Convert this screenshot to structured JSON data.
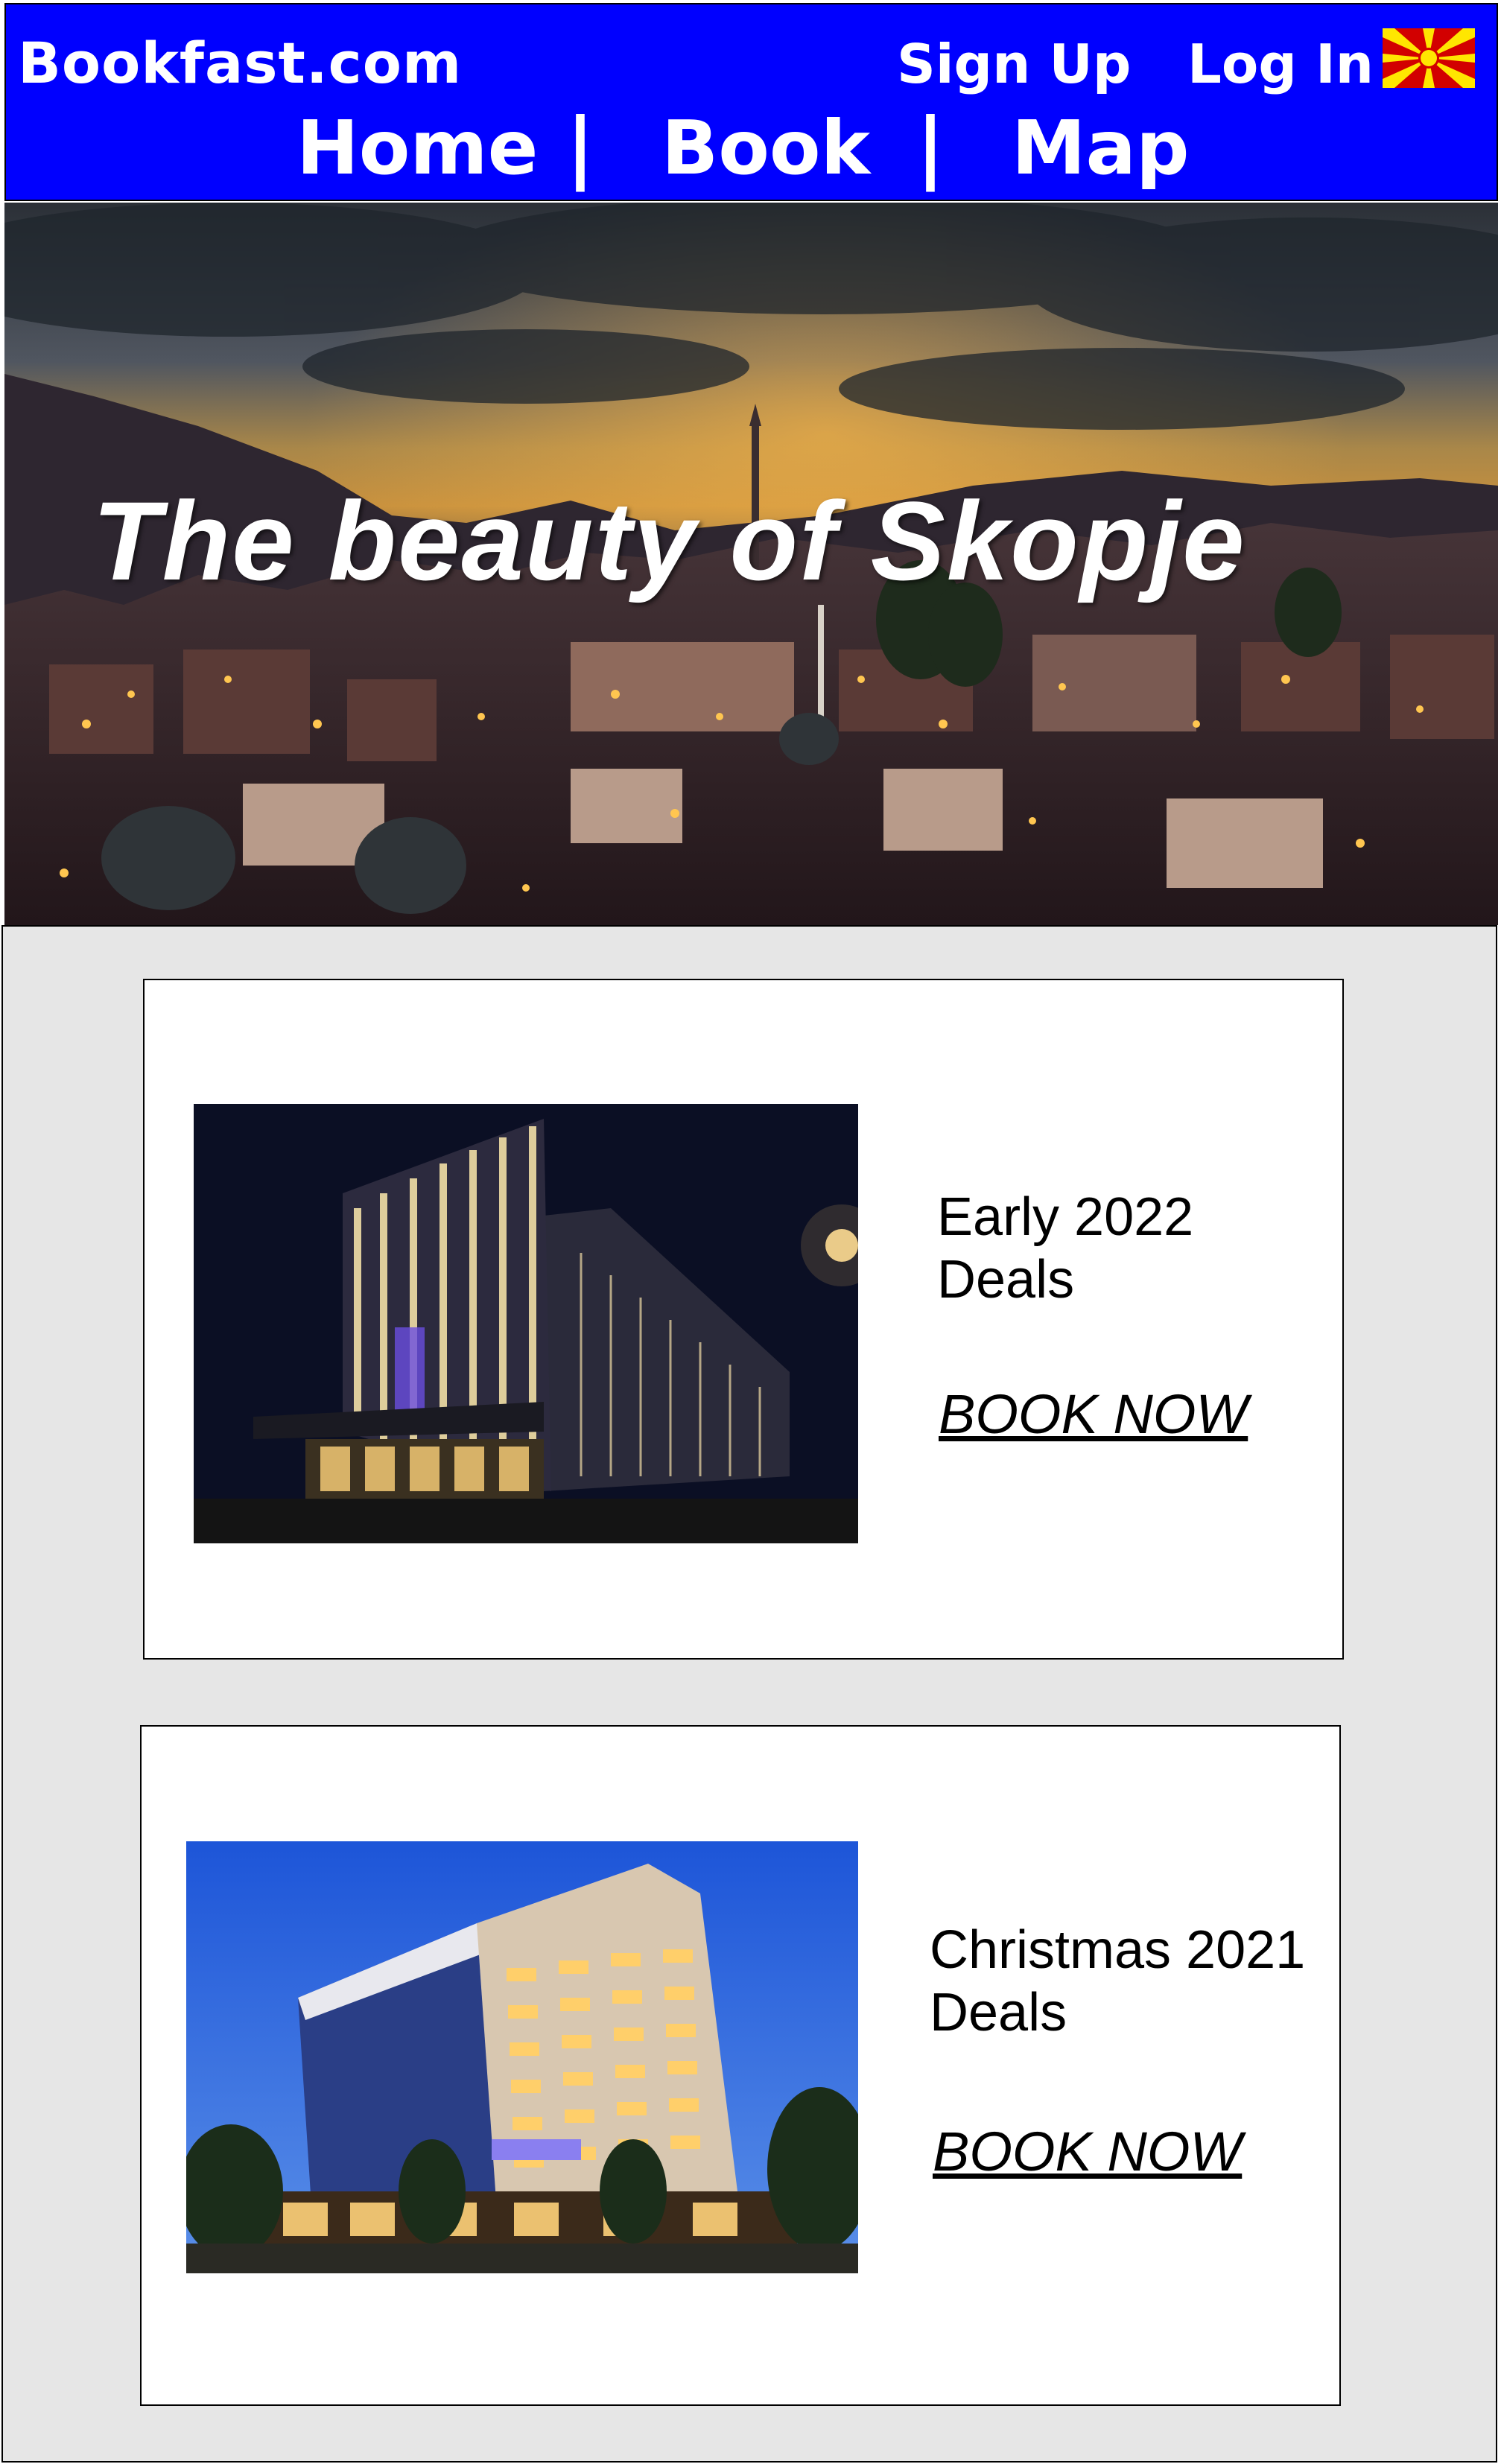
{
  "header": {
    "brand": "Bookfast.com",
    "sign_up": "Sign Up",
    "log_in": "Log In",
    "language_flag": "north-macedonia-flag-icon",
    "nav": [
      {
        "label": "Home"
      },
      {
        "label": "Book"
      },
      {
        "label": "Map"
      }
    ],
    "separator": "|",
    "background_color": "#0000ff"
  },
  "hero": {
    "title": "The beauty of Skopje",
    "image": "skopje-city-night-panorama"
  },
  "deals": [
    {
      "title": "Early 2022\nDeals",
      "cta": "BOOK NOW",
      "image": "luxury-hotel-night-photo"
    },
    {
      "title": "Christmas 2021\nDeals",
      "cta": "BOOK NOW",
      "image": "modern-hotel-dusk-photo"
    }
  ],
  "colors": {
    "content_background": "#e6e6e6",
    "card_background": "#ffffff"
  }
}
